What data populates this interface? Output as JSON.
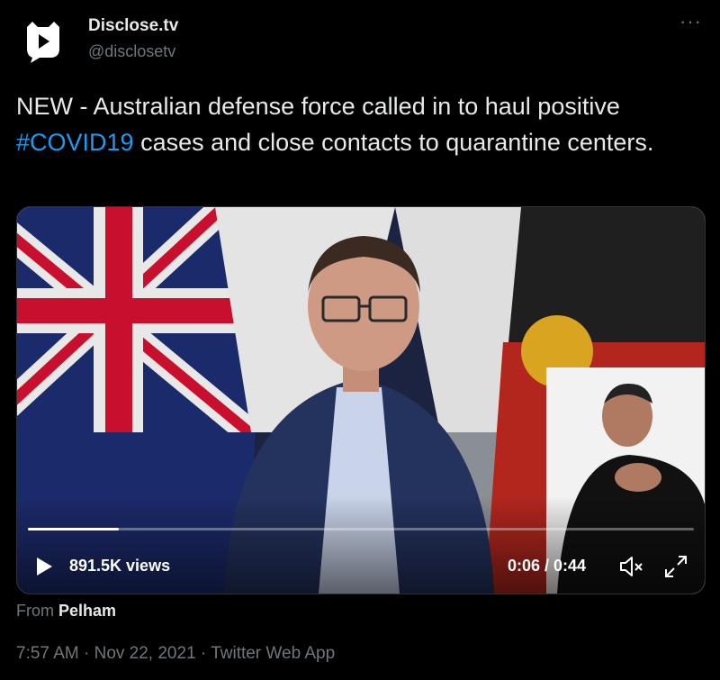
{
  "author": {
    "name": "Disclose.tv",
    "handle": "@disclosetv"
  },
  "header": {
    "more_label": "···"
  },
  "tweet": {
    "text_before": "NEW - Australian defense force called in to haul positive ",
    "hashtag": "#COVID19",
    "text_after": " cases and close contacts to quarantine centers."
  },
  "video": {
    "views": "891.5K views",
    "time": "0:06 / 0:44",
    "progress_fraction": 0.136
  },
  "attribution": {
    "prefix": "From",
    "source": "Pelham"
  },
  "meta": {
    "time": "7:57 AM",
    "date": "Nov 22, 2021",
    "app": "Twitter Web App",
    "separator": "·"
  },
  "colors": {
    "link": "#1d9bf0",
    "secondary": "#71767b",
    "background": "#000000"
  },
  "icons": {
    "avatar": "disclose-logo-icon",
    "play": "play-icon",
    "mute": "volume-muted-icon",
    "fullscreen": "fullscreen-icon",
    "more": "more-icon"
  }
}
